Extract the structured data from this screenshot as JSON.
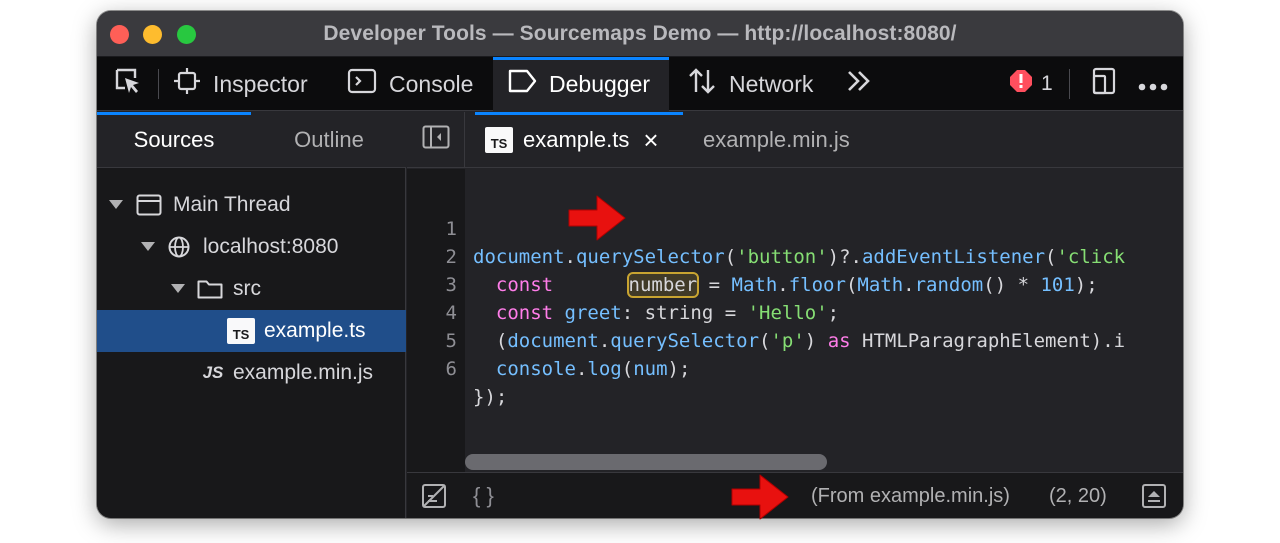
{
  "window": {
    "title": "Developer Tools — Sourcemaps Demo — http://localhost:8080/"
  },
  "toolbar": {
    "tools": [
      {
        "icon": "pick-element-icon",
        "label": ""
      },
      {
        "icon": "inspector-icon",
        "label": "Inspector"
      },
      {
        "icon": "console-icon",
        "label": "Console"
      },
      {
        "icon": "debugger-icon",
        "label": "Debugger",
        "active": true
      },
      {
        "icon": "network-icon",
        "label": "Network"
      }
    ],
    "more_icon": "chevron-double-right-icon",
    "error_count": "1",
    "error_icon": "error-icon",
    "responsive_icon": "responsive-design-icon",
    "menu_icon": "more-options-icon"
  },
  "left_panel": {
    "tabs": [
      {
        "label": "Sources",
        "active": true
      },
      {
        "label": "Outline"
      }
    ],
    "tree": [
      {
        "label": "Main Thread",
        "icon": "window-icon",
        "expanded": true
      },
      {
        "label": "localhost:8080",
        "icon": "globe-icon",
        "expanded": true
      },
      {
        "label": "src",
        "icon": "folder-icon",
        "expanded": true
      },
      {
        "label": "example.ts",
        "icon": "typescript-file-icon",
        "badge": "TS",
        "selected": true
      },
      {
        "label": "example.min.js",
        "icon": "javascript-file-icon",
        "badge": "JS"
      }
    ]
  },
  "editor": {
    "tabs": [
      {
        "label": "example.ts",
        "badge": "TS",
        "active": true,
        "close": "×"
      },
      {
        "label": "example.min.js"
      }
    ],
    "line_numbers": [
      "1",
      "2",
      "3",
      "4",
      "5",
      "6"
    ],
    "lines": [
      "document.querySelector('button')?.addEventListener('click",
      "  const number = Math.floor(Math.random() * 101);",
      "  const greet: string = 'Hello';",
      "  (document.querySelector('p') as HTMLParagraphElement).i",
      "  console.log(num);",
      "});"
    ],
    "highlighted_token": "number",
    "line1": {
      "a": "document",
      "b": ".",
      "c": "querySelector",
      "d": "(",
      "e": "'button'",
      "f": ")?.",
      "g": "addEventListener",
      "h": "(",
      "i": "'click"
    },
    "line2": {
      "a": "  ",
      "b": "const",
      "c": " ",
      "d": "number",
      "e": " = ",
      "f": "Math",
      "g": ".",
      "h": "floor",
      "i": "(",
      "j": "Math",
      "k": ".",
      "l": "random",
      "m": "() * ",
      "n": "101",
      "o": ");"
    },
    "line3": {
      "a": "  ",
      "b": "const",
      "c": " ",
      "d": "greet",
      "e": ": string = ",
      "f": "'Hello'",
      "g": ";"
    },
    "line4": {
      "a": "  (",
      "b": "document",
      "c": ".",
      "d": "querySelector",
      "e": "(",
      "f": "'p'",
      "g": ") ",
      "h": "as",
      "i": " HTMLParagraphElement).i"
    },
    "line5": {
      "a": "  ",
      "b": "console",
      "c": ".",
      "d": "log",
      "e": "(",
      "f": "num",
      "g": ");"
    },
    "line6": {
      "a": "});"
    }
  },
  "footer": {
    "blackbox_icon": "blackbox-icon",
    "pretty_print": "{ }",
    "mapped_from": "(From example.min.js)",
    "cursor_position": "(2, 20)",
    "toggle_icon": "toggle-panel-icon"
  },
  "colors": {
    "accent": "#0a84ff",
    "selection": "#204e8a",
    "keyword": "#ff7de9",
    "function": "#75bfff",
    "string": "#86de74",
    "annotation_arrow": "#e8110f",
    "highlight_outline": "#c8a431"
  }
}
